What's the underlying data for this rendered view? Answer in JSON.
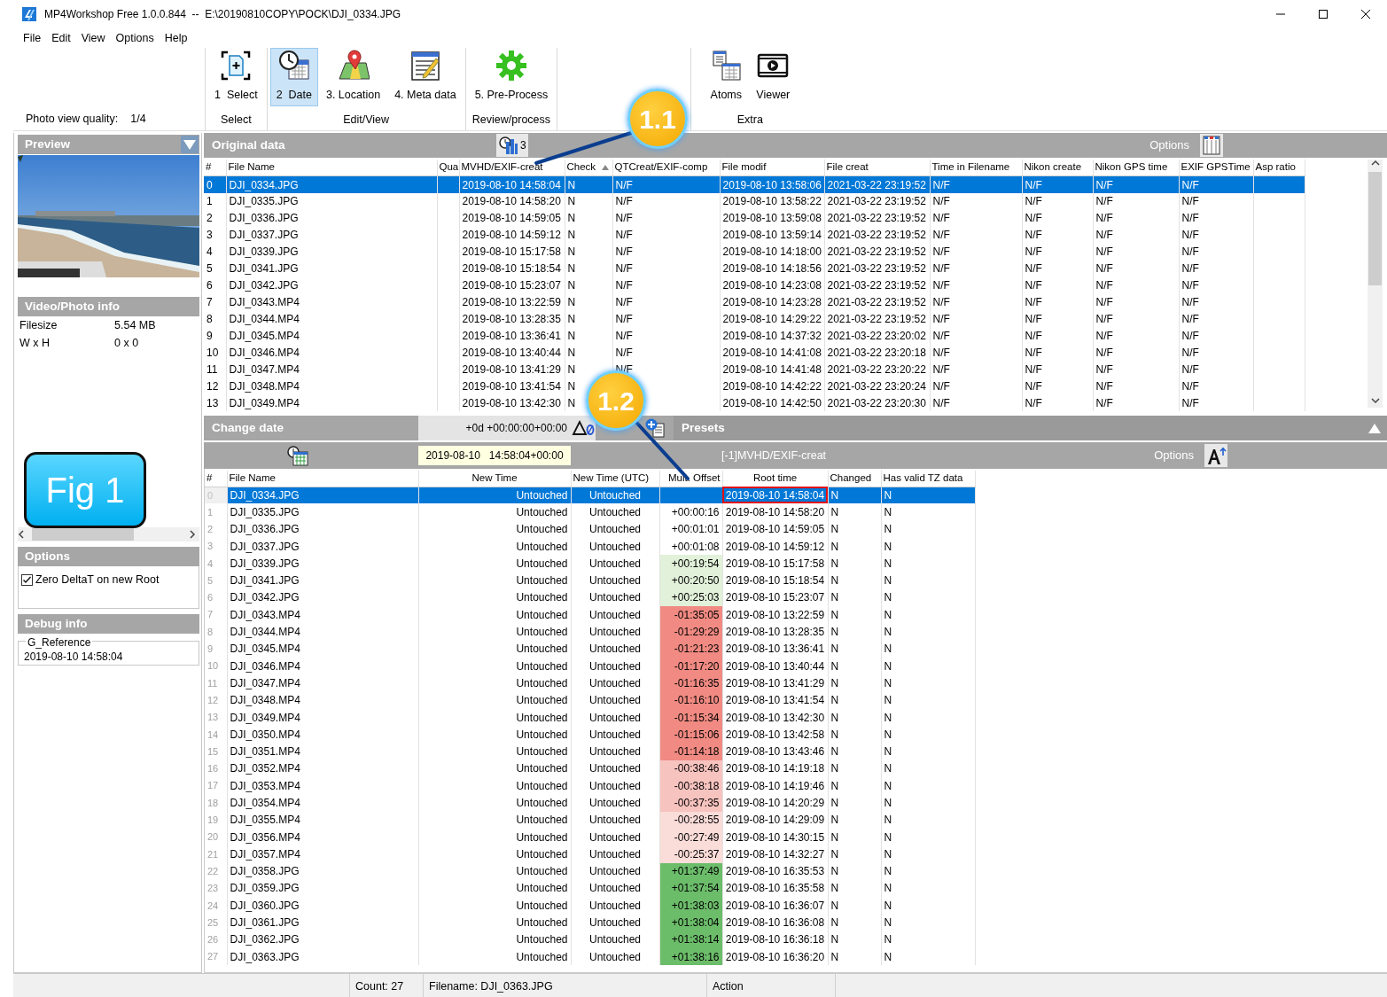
{
  "window": {
    "title": "MP4Workshop Free 1.0.0.844  --  E:\\20190810COPY\\POCK\\DJI_0334.JPG"
  },
  "menu": [
    "File",
    "Edit",
    "View",
    "Options",
    "Help"
  ],
  "toolbar": {
    "quality_label": "Photo view quality:",
    "quality_value": "1/4",
    "groups": [
      {
        "label": "Select",
        "buttons": [
          {
            "label": "1  Select",
            "selected": false
          }
        ]
      },
      {
        "label": "Edit/View",
        "buttons": [
          {
            "label": "2  Date",
            "selected": true
          },
          {
            "label": "3. Location",
            "selected": false
          },
          {
            "label": "4. Meta data",
            "selected": false
          }
        ]
      },
      {
        "label": "Review/process",
        "buttons": [
          {
            "label": "5. Pre-Process",
            "selected": false
          }
        ]
      },
      {
        "label": "Extra",
        "buttons": [
          {
            "label": "Atoms",
            "selected": false
          },
          {
            "label": "Viewer",
            "selected": false
          }
        ]
      }
    ]
  },
  "preview": {
    "title": "Preview"
  },
  "info": {
    "title": "Video/Photo info",
    "rows": [
      {
        "label": "Filesize",
        "value": "5.54 MB"
      },
      {
        "label": "W x H",
        "value": "0 x 0"
      }
    ]
  },
  "options": {
    "title": "Options",
    "checkboxes": [
      {
        "label": "Zero DeltaT on new Root",
        "checked": true
      }
    ]
  },
  "debug": {
    "title": "Debug info",
    "group_label": "G_Reference",
    "value": "2019-08-10 14:58:04"
  },
  "original_data": {
    "title": "Original data",
    "column_count": "3",
    "options_label": "Options",
    "columns": [
      {
        "label": "#",
        "sorted": false
      },
      {
        "label": "File Name",
        "sorted": false
      },
      {
        "label": "Qua",
        "sorted": false
      },
      {
        "label": "MVHD/EXIF-creat",
        "sorted": false
      },
      {
        "label": "Check",
        "sorted": true
      },
      {
        "label": "QTCreat/EXIF-comp",
        "sorted": false
      },
      {
        "label": "File modif",
        "sorted": false
      },
      {
        "label": "File creat",
        "sorted": false
      },
      {
        "label": "Time in Filename",
        "sorted": false
      },
      {
        "label": "Nikon create",
        "sorted": false
      },
      {
        "label": "Nikon GPS time",
        "sorted": false
      },
      {
        "label": "EXIF GPSTime",
        "sorted": false
      },
      {
        "label": "Asp ratio",
        "sorted": false
      }
    ],
    "rows": [
      {
        "selected": true,
        "cells": [
          "0",
          "DJI_0334.JPG",
          null,
          "2019-08-10 14:58:04",
          "N",
          "N/F",
          "2019-08-10 13:58:06",
          "2021-03-22 23:19:52",
          "N/F",
          "N/F",
          "N/F",
          "N/F",
          null
        ]
      },
      {
        "selected": false,
        "cells": [
          "1",
          "DJI_0335.JPG",
          null,
          "2019-08-10 14:58:20",
          "N",
          "N/F",
          "2019-08-10 13:58:22",
          "2021-03-22 23:19:52",
          "N/F",
          "N/F",
          "N/F",
          "N/F",
          null
        ]
      },
      {
        "selected": false,
        "cells": [
          "2",
          "DJI_0336.JPG",
          null,
          "2019-08-10 14:59:05",
          "N",
          "N/F",
          "2019-08-10 13:59:08",
          "2021-03-22 23:19:52",
          "N/F",
          "N/F",
          "N/F",
          "N/F",
          null
        ]
      },
      {
        "selected": false,
        "cells": [
          "3",
          "DJI_0337.JPG",
          null,
          "2019-08-10 14:59:12",
          "N",
          "N/F",
          "2019-08-10 13:59:14",
          "2021-03-22 23:19:52",
          "N/F",
          "N/F",
          "N/F",
          "N/F",
          null
        ]
      },
      {
        "selected": false,
        "cells": [
          "4",
          "DJI_0339.JPG",
          null,
          "2019-08-10 15:17:58",
          "N",
          "N/F",
          "2019-08-10 14:18:00",
          "2021-03-22 23:19:52",
          "N/F",
          "N/F",
          "N/F",
          "N/F",
          null
        ]
      },
      {
        "selected": false,
        "cells": [
          "5",
          "DJI_0341.JPG",
          null,
          "2019-08-10 15:18:54",
          "N",
          "N/F",
          "2019-08-10 14:18:56",
          "2021-03-22 23:19:52",
          "N/F",
          "N/F",
          "N/F",
          "N/F",
          null
        ]
      },
      {
        "selected": false,
        "cells": [
          "6",
          "DJI_0342.JPG",
          null,
          "2019-08-10 15:23:07",
          "N",
          "N/F",
          "2019-08-10 14:23:08",
          "2021-03-22 23:19:52",
          "N/F",
          "N/F",
          "N/F",
          "N/F",
          null
        ]
      },
      {
        "selected": false,
        "cells": [
          "7",
          "DJI_0343.MP4",
          null,
          "2019-08-10 13:22:59",
          "N",
          "N/F",
          "2019-08-10 14:23:28",
          "2021-03-22 23:19:52",
          "N/F",
          "N/F",
          "N/F",
          "N/F",
          null
        ]
      },
      {
        "selected": false,
        "cells": [
          "8",
          "DJI_0344.MP4",
          null,
          "2019-08-10 13:28:35",
          "N",
          "N/F",
          "2019-08-10 14:29:22",
          "2021-03-22 23:19:52",
          "N/F",
          "N/F",
          "N/F",
          "N/F",
          null
        ]
      },
      {
        "selected": false,
        "cells": [
          "9",
          "DJI_0345.MP4",
          null,
          "2019-08-10 13:36:41",
          "N",
          "N/F",
          "2019-08-10 14:37:32",
          "2021-03-22 23:20:02",
          "N/F",
          "N/F",
          "N/F",
          "N/F",
          null
        ]
      },
      {
        "selected": false,
        "cells": [
          "10",
          "DJI_0346.MP4",
          null,
          "2019-08-10 13:40:44",
          "N",
          "N/F",
          "2019-08-10 14:41:08",
          "2021-03-22 23:20:18",
          "N/F",
          "N/F",
          "N/F",
          "N/F",
          null
        ]
      },
      {
        "selected": false,
        "cells": [
          "11",
          "DJI_0347.MP4",
          null,
          "2019-08-10 13:41:29",
          "N",
          "N/F",
          "2019-08-10 14:41:48",
          "2021-03-22 23:20:22",
          "N/F",
          "N/F",
          "N/F",
          "N/F",
          null
        ]
      },
      {
        "selected": false,
        "cells": [
          "12",
          "DJI_0348.MP4",
          null,
          "2019-08-10 13:41:54",
          "N",
          null,
          "2019-08-10 14:42:22",
          "2021-03-22 23:20:24",
          "N/F",
          "N/F",
          "N/F",
          "N/F",
          null
        ]
      },
      {
        "selected": false,
        "cells": [
          "13",
          "DJI_0349.MP4",
          null,
          "2019-08-10 13:42:30",
          "N",
          null,
          "2019-08-10 14:42:50",
          "2021-03-22 23:20:30",
          "N/F",
          "N/F",
          "N/F",
          "N/F",
          null
        ]
      }
    ]
  },
  "change_date": {
    "title": "Change date",
    "offset_value": "+0d  +00:00:00+00:00",
    "date_value": "2019-08-10   14:58:04+00:00"
  },
  "presets": {
    "title": "Presets",
    "expanded": true,
    "source": "[-1]MVHD/EXIF-creat",
    "options_label": "Options"
  },
  "changes": {
    "columns": [
      "#",
      "File Name",
      "New Time",
      "New Time (UTC)",
      "Mult. Offset",
      "Root time",
      "Changed",
      "Has valid TZ data"
    ],
    "rows": [
      {
        "selected": true,
        "root_marked": true,
        "cells": [
          "0",
          "DJI_0334.JPG",
          "Untouched",
          "Untouched",
          null,
          "2019-08-10 14:58:04",
          "N",
          "N"
        ]
      },
      {
        "selected": false,
        "root_marked": false,
        "color": "#ffffff",
        "cells": [
          "1",
          "DJI_0335.JPG",
          "Untouched",
          "Untouched",
          "+00:00:16",
          "2019-08-10 14:58:20",
          "N",
          "N"
        ]
      },
      {
        "selected": false,
        "root_marked": false,
        "color": "#ffffff",
        "cells": [
          "2",
          "DJI_0336.JPG",
          "Untouched",
          "Untouched",
          "+00:01:01",
          "2019-08-10 14:59:05",
          "N",
          "N"
        ]
      },
      {
        "selected": false,
        "root_marked": false,
        "color": "#ffffff",
        "cells": [
          "3",
          "DJI_0337.JPG",
          "Untouched",
          "Untouched",
          "+00:01:08",
          "2019-08-10 14:59:12",
          "N",
          "N"
        ]
      },
      {
        "selected": false,
        "root_marked": false,
        "color": "#e2f1da",
        "cells": [
          "4",
          "DJI_0339.JPG",
          "Untouched",
          "Untouched",
          "+00:19:54",
          "2019-08-10 15:17:58",
          "N",
          "N"
        ]
      },
      {
        "selected": false,
        "root_marked": false,
        "color": "#e2f1da",
        "cells": [
          "5",
          "DJI_0341.JPG",
          "Untouched",
          "Untouched",
          "+00:20:50",
          "2019-08-10 15:18:54",
          "N",
          "N"
        ]
      },
      {
        "selected": false,
        "root_marked": false,
        "color": "#e2f1da",
        "cells": [
          "6",
          "DJI_0342.JPG",
          "Untouched",
          "Untouched",
          "+00:25:03",
          "2019-08-10 15:23:07",
          "N",
          "N"
        ]
      },
      {
        "selected": false,
        "root_marked": false,
        "color": "#f08a82",
        "cells": [
          "7",
          "DJI_0343.MP4",
          "Untouched",
          "Untouched",
          "-01:35:05",
          "2019-08-10 13:22:59",
          "N",
          "N"
        ]
      },
      {
        "selected": false,
        "root_marked": false,
        "color": "#f08a82",
        "cells": [
          "8",
          "DJI_0344.MP4",
          "Untouched",
          "Untouched",
          "-01:29:29",
          "2019-08-10 13:28:35",
          "N",
          "N"
        ]
      },
      {
        "selected": false,
        "root_marked": false,
        "color": "#f08a82",
        "cells": [
          "9",
          "DJI_0345.MP4",
          "Untouched",
          "Untouched",
          "-01:21:23",
          "2019-08-10 13:36:41",
          "N",
          "N"
        ]
      },
      {
        "selected": false,
        "root_marked": false,
        "color": "#f08a82",
        "cells": [
          "10",
          "DJI_0346.MP4",
          "Untouched",
          "Untouched",
          "-01:17:20",
          "2019-08-10 13:40:44",
          "N",
          "N"
        ]
      },
      {
        "selected": false,
        "root_marked": false,
        "color": "#f08a82",
        "cells": [
          "11",
          "DJI_0347.MP4",
          "Untouched",
          "Untouched",
          "-01:16:35",
          "2019-08-10 13:41:29",
          "N",
          "N"
        ]
      },
      {
        "selected": false,
        "root_marked": false,
        "color": "#f08a82",
        "cells": [
          "12",
          "DJI_0348.MP4",
          "Untouched",
          "Untouched",
          "-01:16:10",
          "2019-08-10 13:41:54",
          "N",
          "N"
        ]
      },
      {
        "selected": false,
        "root_marked": false,
        "color": "#f08a82",
        "cells": [
          "13",
          "DJI_0349.MP4",
          "Untouched",
          "Untouched",
          "-01:15:34",
          "2019-08-10 13:42:30",
          "N",
          "N"
        ]
      },
      {
        "selected": false,
        "root_marked": false,
        "color": "#f08a82",
        "cells": [
          "14",
          "DJI_0350.MP4",
          "Untouched",
          "Untouched",
          "-01:15:06",
          "2019-08-10 13:42:58",
          "N",
          "N"
        ]
      },
      {
        "selected": false,
        "root_marked": false,
        "color": "#f08a82",
        "cells": [
          "15",
          "DJI_0351.MP4",
          "Untouched",
          "Untouched",
          "-01:14:18",
          "2019-08-10 13:43:46",
          "N",
          "N"
        ]
      },
      {
        "selected": false,
        "root_marked": false,
        "color": "#f7c3bf",
        "cells": [
          "16",
          "DJI_0352.MP4",
          "Untouched",
          "Untouched",
          "-00:38:46",
          "2019-08-10 14:19:18",
          "N",
          "N"
        ]
      },
      {
        "selected": false,
        "root_marked": false,
        "color": "#f7c3bf",
        "cells": [
          "17",
          "DJI_0353.MP4",
          "Untouched",
          "Untouched",
          "-00:38:18",
          "2019-08-10 14:19:46",
          "N",
          "N"
        ]
      },
      {
        "selected": false,
        "root_marked": false,
        "color": "#f7c3bf",
        "cells": [
          "18",
          "DJI_0354.MP4",
          "Untouched",
          "Untouched",
          "-00:37:35",
          "2019-08-10 14:20:29",
          "N",
          "N"
        ]
      },
      {
        "selected": false,
        "root_marked": false,
        "color": "#fadcd9",
        "cells": [
          "19",
          "DJI_0355.MP4",
          "Untouched",
          "Untouched",
          "-00:28:55",
          "2019-08-10 14:29:09",
          "N",
          "N"
        ]
      },
      {
        "selected": false,
        "root_marked": false,
        "color": "#fadcd9",
        "cells": [
          "20",
          "DJI_0356.MP4",
          "Untouched",
          "Untouched",
          "-00:27:49",
          "2019-08-10 14:30:15",
          "N",
          "N"
        ]
      },
      {
        "selected": false,
        "root_marked": false,
        "color": "#fadcd9",
        "cells": [
          "21",
          "DJI_0357.MP4",
          "Untouched",
          "Untouched",
          "-00:25:37",
          "2019-08-10 14:32:27",
          "N",
          "N"
        ]
      },
      {
        "selected": false,
        "root_marked": false,
        "color": "#6cbd6a",
        "cells": [
          "22",
          "DJI_0358.JPG",
          "Untouched",
          "Untouched",
          "+01:37:49",
          "2019-08-10 16:35:53",
          "N",
          "N"
        ]
      },
      {
        "selected": false,
        "root_marked": false,
        "color": "#6cbd6a",
        "cells": [
          "23",
          "DJI_0359.JPG",
          "Untouched",
          "Untouched",
          "+01:37:54",
          "2019-08-10 16:35:58",
          "N",
          "N"
        ]
      },
      {
        "selected": false,
        "root_marked": false,
        "color": "#6cbd6a",
        "cells": [
          "24",
          "DJI_0360.JPG",
          "Untouched",
          "Untouched",
          "+01:38:03",
          "2019-08-10 16:36:07",
          "N",
          "N"
        ]
      },
      {
        "selected": false,
        "root_marked": false,
        "color": "#6cbd6a",
        "cells": [
          "25",
          "DJI_0361.JPG",
          "Untouched",
          "Untouched",
          "+01:38:04",
          "2019-08-10 16:36:08",
          "N",
          "N"
        ]
      },
      {
        "selected": false,
        "root_marked": false,
        "color": "#6cbd6a",
        "cells": [
          "26",
          "DJI_0362.JPG",
          "Untouched",
          "Untouched",
          "+01:38:14",
          "2019-08-10 16:36:18",
          "N",
          "N"
        ]
      },
      {
        "selected": false,
        "root_marked": false,
        "color": "#6cbd6a",
        "cells": [
          "27",
          "DJI_0363.JPG",
          "Untouched",
          "Untouched",
          "+01:38:16",
          "2019-08-10 16:36:20",
          "N",
          "N"
        ]
      }
    ]
  },
  "status_bar": [
    "Count: 27",
    "Filename: DJI_0363.JPG",
    "Action"
  ],
  "annotations": {
    "callouts": [
      "1.1",
      "1.2"
    ],
    "figure_label": "Fig 1"
  }
}
